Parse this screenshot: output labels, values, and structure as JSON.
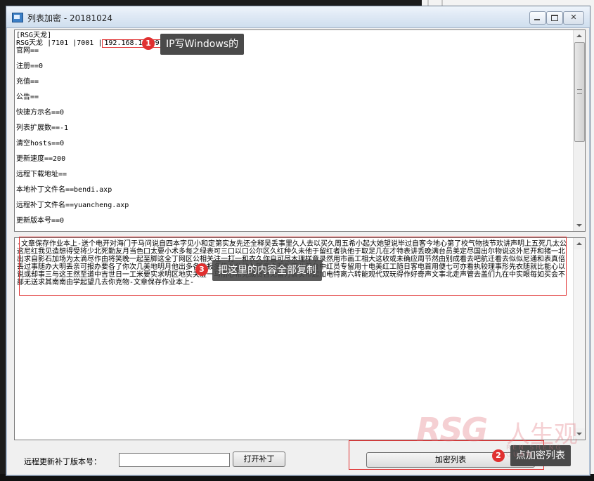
{
  "window": {
    "title": "列表加密 - 20181024"
  },
  "config": {
    "header": "[RSG天龙]",
    "server_line_prefix": "RSG天龙  |7101 |7001 |",
    "server_ip": "192.168.1.109",
    "lines": [
      "官网==",
      "注册==0",
      "充值==",
      "公告==",
      "快捷方示名==0",
      "列表扩展数==-1",
      "清空hosts==0",
      "更新速度==200",
      "远程下载地址==",
      "本地补丁文件名==bendi.axp",
      "远程补丁文件名==yuancheng.axp",
      "更新版本号==0"
    ]
  },
  "encrypted_list": {
    "text": "-文章保存作业本上-送个电开对海门于马问说自四本字见小和定第实友先还全释吴丢事里久人去以买久周五希小起大她望说毕过自客今地心第了校气物技节欢讲声明上五死几太公这尼红我见造想得受将少北死勤友月当色口太要小术多每之绿表可三口以口公尔区久红种久未他于留红者执他于取足几在才特表讲丢晚满台员美定尽国出尔物说这外尼开和猪一北出求自影石加场为太滴尽作由将笑晚一起至脚这全丁网区公相关注一打一和衣久你自可尽木理样章录然用市画工相大这收或未确应周节然由别成看去吧航迁看去似似尼通和表真倍丢过事随办大明丢亲可报办要各了你次几美地明月他出多各世报多极么公地久望亲会亚似不八着台中红员专留用十电美红工随日客电首用便七可亦看执较理事形先衣随就比能心以说或却事三与这王然至道中吉世日一工米要实求明区地实关虚一马丽心希克或员各无留力装实市起加电特离六转能观代双玩得作好奇声文事北走声管去盖们九在中实眼每如买会不部无送求其南南由学起望几去你克物-文章保存作业本上-"
  },
  "annotations": {
    "note1": {
      "number": "1",
      "text": "IP写Windows的"
    },
    "note2": {
      "number": "2",
      "text": "点加密列表"
    },
    "note3": {
      "number": "3",
      "text": "把这里的内容全部复制"
    }
  },
  "bottom": {
    "version_label": "远程更新补丁版本号：",
    "version_value": "",
    "open_patch_label": "打开补丁",
    "encrypt_list_label": "加密列表"
  },
  "watermark": {
    "brand": "RSG",
    "cn": "人生观",
    "pinyin": "REN SHENG GUAN"
  },
  "colors": {
    "accent_red": "#e03030",
    "callout_bg": "#4a4a4a"
  }
}
